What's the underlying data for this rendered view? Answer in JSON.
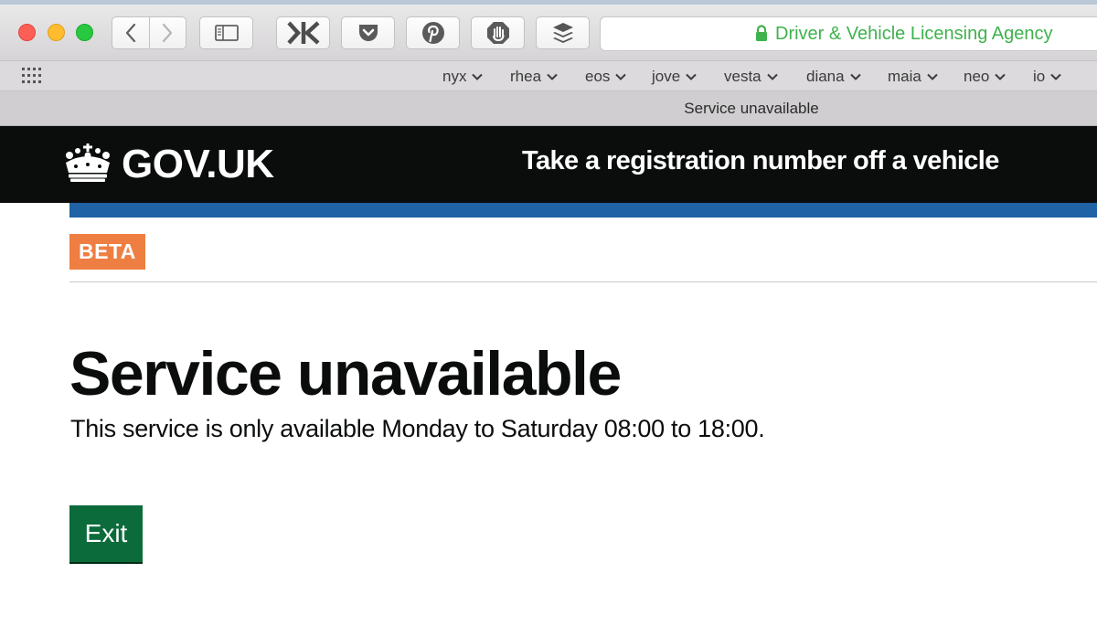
{
  "browser": {
    "url_display": "Driver & Vehicle Licensing Agency",
    "tab_title": "Service unavailable",
    "bookmarks": [
      {
        "label": "nyx"
      },
      {
        "label": "rhea"
      },
      {
        "label": "eos"
      },
      {
        "label": "jove"
      },
      {
        "label": "vesta"
      },
      {
        "label": "diana"
      },
      {
        "label": "maia"
      },
      {
        "label": "neo"
      },
      {
        "label": "io"
      }
    ],
    "toolbar_icons": [
      "back-icon",
      "forward-icon",
      "sidebar-icon",
      "kippt-icon",
      "pocket-icon",
      "pinterest-icon",
      "adblock-icon",
      "buffer-icon"
    ],
    "secure_color": "#3fb24d"
  },
  "page": {
    "logo_text": "GOV.UK",
    "service_name": "Take a registration number off a vehicle",
    "phase_tag": "BETA",
    "heading": "Service unavailable",
    "body": "This service is only available Monday to Saturday 08:00 to 18:00.",
    "exit_label": "Exit",
    "colors": {
      "header_bg": "#0b0c0c",
      "header_rule": "#1f62a6",
      "beta_tag": "#ef7e42",
      "button": "#0b6b3b"
    }
  }
}
